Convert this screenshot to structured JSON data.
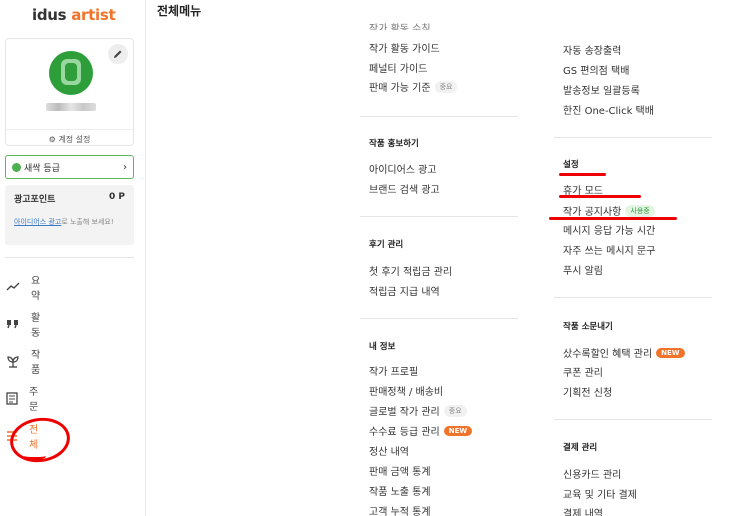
{
  "brand": {
    "logo_prefix": "idus",
    "logo_suffix": "artist"
  },
  "page_title": "전체메뉴",
  "profile": {
    "account_settings": "계정 설정"
  },
  "grade_button": "새싹 등급",
  "ad_points": {
    "label": "광고포인트",
    "value": "0 P",
    "desc_link": "아이디어스 광고",
    "desc_rest": "로 노출해 보세요!"
  },
  "nav": [
    "요약",
    "활동",
    "작품",
    "주문",
    "전체"
  ],
  "col1": {
    "top_partial": "작가 활동 수칙",
    "group0": [
      "작가 활동 가이드",
      "페널티 가이드",
      "판매 가능 기준"
    ],
    "group0_tag": "중요",
    "sec_promo": {
      "title": "작품 홍보하기",
      "items": [
        "아이디어스 광고",
        "브랜드 검색 광고"
      ]
    },
    "sec_review": {
      "title": "후기 관리",
      "items": [
        "첫 후기 적립금 관리",
        "적립금 지급 내역"
      ]
    },
    "sec_info": {
      "title": "내 정보",
      "items": [
        "작가 프로필",
        "판매정책 / 배송비",
        "글로벌 작가 관리",
        "수수료 등급 관리",
        "정산 내역",
        "판매 금액 통계",
        "작품 노출 통계",
        "고객 누적 통계"
      ],
      "tag_global": "중요",
      "tag_fee": "NEW"
    }
  },
  "col2": {
    "group0": [
      "자동 송장출력",
      "GS 편의점 택배",
      "발송정보 일괄등록",
      "한진 One-Click 택배"
    ],
    "sec_settings": {
      "title": "설정",
      "items": [
        "휴가 모드",
        "작가 공지사항",
        "메시지 응답 가능 시간",
        "자주 쓰는 메시지 문구",
        "푸시 알림"
      ],
      "tag_notice": "사용중"
    },
    "sec_promo": {
      "title": "작품 소문내기",
      "items": [
        "샀수록할인 혜택 관리",
        "쿠폰 관리",
        "기획전 신청"
      ],
      "tag_new": "NEW"
    },
    "sec_payment": {
      "title": "결제 관리",
      "items": [
        "신용카드 관리",
        "교육 및 기타 결제",
        "결제 내역"
      ]
    }
  }
}
